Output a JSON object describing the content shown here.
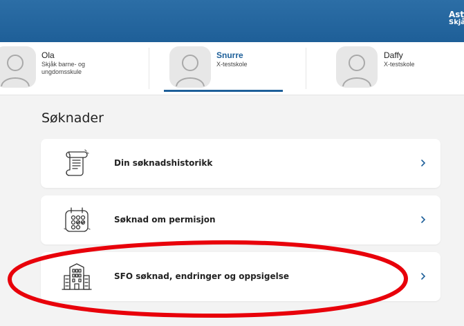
{
  "header": {
    "user_line1": "Ast",
    "user_line2": "Skjå"
  },
  "children": [
    {
      "name": "Ola",
      "school": "Skjåk barne- og ungdomsskule",
      "active": false
    },
    {
      "name": "Snurre",
      "school": "X-testskole",
      "active": true
    },
    {
      "name": "Daffy",
      "school": "X-testskole",
      "active": false
    }
  ],
  "section": {
    "title": "Søknader"
  },
  "cards": [
    {
      "label": "Din søknadshistorikk",
      "icon": "scroll-document-icon"
    },
    {
      "label": "Søknad om permisjon",
      "icon": "calendar-check-icon"
    },
    {
      "label": "SFO søknad, endringer og oppsigelse",
      "icon": "school-building-icon"
    }
  ],
  "colors": {
    "header": "#1e5f98",
    "accent": "#1d5f99",
    "annotation": "#e8000a",
    "background": "#f3f3f3"
  }
}
